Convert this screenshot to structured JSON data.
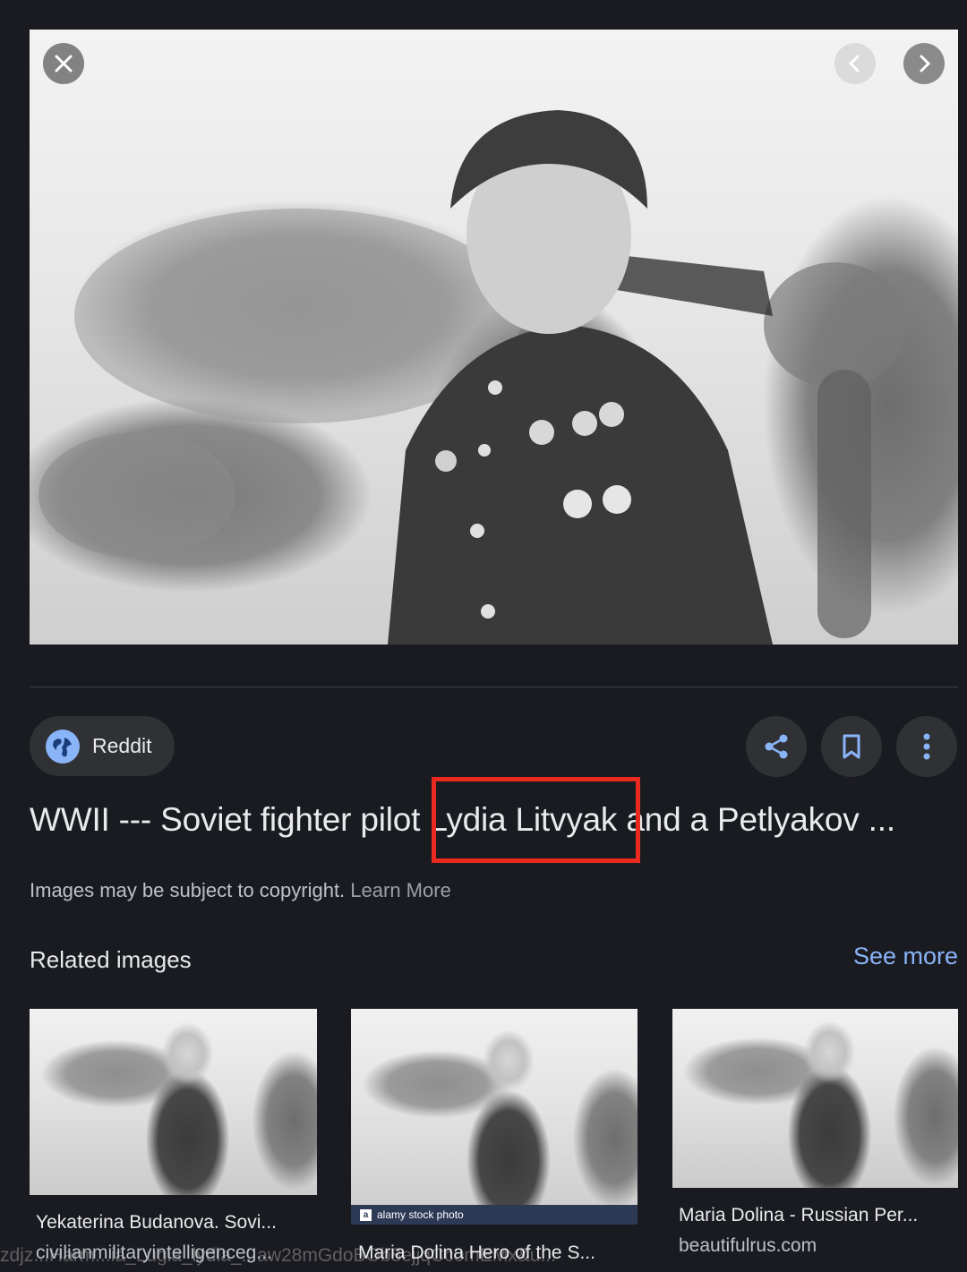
{
  "viewer": {
    "close_icon": "close-icon",
    "prev_icon": "chevron-left-icon",
    "next_icon": "chevron-right-icon"
  },
  "source": {
    "label": "Reddit",
    "icon": "globe-icon"
  },
  "actions": {
    "share_icon": "share-icon",
    "save_icon": "bookmark-icon",
    "more_icon": "more-vert-icon"
  },
  "title": {
    "before": "WWII --- Soviet fighter pilot ",
    "highlight": "Lydia Litvyak",
    "after": " and a Petlyakov ..."
  },
  "highlight_color": "#ea2a1e",
  "copyright": {
    "text": "Images may be subject to copyright.",
    "link": "Learn More"
  },
  "related": {
    "heading": "Related images",
    "see_more": "See more",
    "items": [
      {
        "caption": "Yekaterina Budanova. Sovi...",
        "domain": "civilianmilitaryintelligenceg..."
      },
      {
        "caption": "Maria Dolina Hero of the S...",
        "watermark": "alamy stock photo"
      },
      {
        "caption": "Maria Dolina - Russian Per...",
        "domain": "beautifulrus.com"
      }
    ]
  },
  "url_overlay": "zdjz...Harm...ia_Lugia_lydia_...aw28mGdoBOb8ejjqCc0mEMx&u..."
}
